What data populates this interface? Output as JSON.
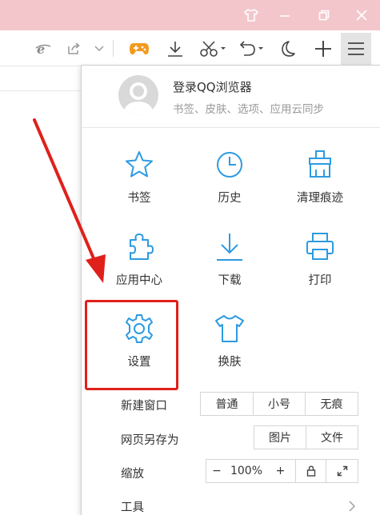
{
  "window": {
    "skin_icon": "tshirt-icon",
    "minimize_icon": "minimize-icon",
    "restore_icon": "restore-icon",
    "close_icon": "close-icon"
  },
  "toolbar": {
    "icons": [
      "ie-compat-icon",
      "share-icon",
      "chevron-down-icon",
      "game-icon",
      "download-icon",
      "scissors-icon",
      "undo-icon",
      "night-mode-icon",
      "add-tab-icon",
      "menu-icon"
    ],
    "game_color": "#f39a1e",
    "accent": "#2d9be0"
  },
  "menu": {
    "login_title": "登录QQ浏览器",
    "login_subtitle": "书签、皮肤、选项、应用云同步",
    "grid": [
      {
        "label": "书签",
        "icon": "star-icon"
      },
      {
        "label": "历史",
        "icon": "clock-icon"
      },
      {
        "label": "清理痕迹",
        "icon": "broom-icon"
      },
      {
        "label": "应用中心",
        "icon": "puzzle-icon"
      },
      {
        "label": "下载",
        "icon": "download-icon"
      },
      {
        "label": "打印",
        "icon": "printer-icon"
      },
      {
        "label": "设置",
        "icon": "gear-icon"
      },
      {
        "label": "换肤",
        "icon": "tshirt-icon"
      }
    ],
    "new_window": {
      "label": "新建窗口",
      "options": [
        "普通",
        "小号",
        "无痕"
      ]
    },
    "save_page": {
      "label": "网页另存为",
      "options": [
        "图片",
        "文件"
      ]
    },
    "zoom": {
      "label": "缩放",
      "minus": "−",
      "value": "100%",
      "plus": "+"
    },
    "tools": {
      "label": "工具"
    }
  },
  "highlight_color": "#e0201b"
}
